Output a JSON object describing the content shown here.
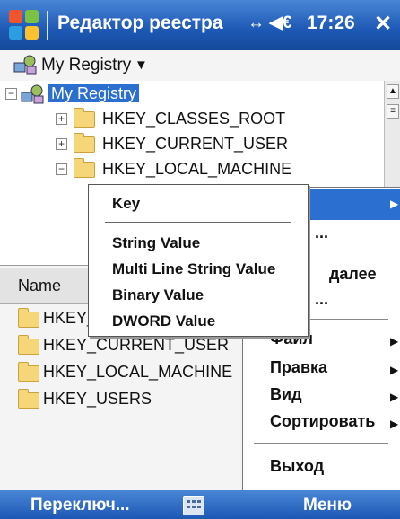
{
  "title_bar": {
    "app_title": "Редактор реестра",
    "status_icons": "↔ ◀€",
    "time": "17:26",
    "close_label": "✕"
  },
  "registry_selector": {
    "label": "My Registry",
    "caret": "▼"
  },
  "tree": {
    "root": "My Registry",
    "nodes": [
      {
        "label": "HKEY_CLASSES_ROOT",
        "expander": "+"
      },
      {
        "label": "HKEY_CURRENT_USER",
        "expander": "+"
      },
      {
        "label": "HKEY_LOCAL_MACHINE",
        "expander": "−"
      }
    ]
  },
  "list": {
    "column_header": "Name",
    "items": [
      "HKEY_CLASSES_ROOT",
      "HKEY_CURRENT_USER",
      "HKEY_LOCAL_MACHINE",
      "HKEY_USERS"
    ]
  },
  "main_menu": {
    "items": [
      {
        "label": "",
        "arrow": "▶"
      },
      {
        "label": "...",
        "arrow": ""
      },
      {
        "label": "далее",
        "arrow": ""
      },
      {
        "label": "...",
        "arrow": ""
      },
      {
        "label": "Файл",
        "arrow": "▶"
      },
      {
        "label": "Правка",
        "arrow": "▶"
      },
      {
        "label": "Вид",
        "arrow": "▶"
      },
      {
        "label": "Сортировать",
        "arrow": "▶"
      },
      {
        "label": "Выход",
        "arrow": ""
      }
    ]
  },
  "new_submenu": {
    "key": "Key",
    "values": [
      "String Value",
      "Multi Line String Value",
      "Binary Value",
      "DWORD Value"
    ]
  },
  "bottom_bar": {
    "left_softkey": "Переключ...",
    "right_softkey": "Меню"
  },
  "colors": {
    "accent": "#1c58b4",
    "selection": "#2b6fd1"
  },
  "icons": [
    "windows-start-icon",
    "connectivity-icon",
    "volume-icon",
    "registry-icon",
    "folder-icon",
    "keyboard-icon"
  ]
}
